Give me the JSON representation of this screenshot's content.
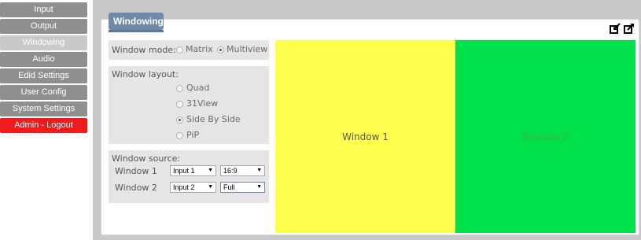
{
  "sidebar": {
    "items": [
      {
        "label": "Input"
      },
      {
        "label": "Output"
      },
      {
        "label": "Windowing"
      },
      {
        "label": "Audio"
      },
      {
        "label": "Edid Settings"
      },
      {
        "label": "User Config"
      },
      {
        "label": "System Settings"
      },
      {
        "label": "Admin - Logout"
      }
    ]
  },
  "page": {
    "title": "Windowing"
  },
  "window_mode": {
    "label": "Window mode:",
    "options": [
      "Matrix",
      "Multiview"
    ],
    "selected": "Multiview"
  },
  "window_layout": {
    "label": "Window layout:",
    "options": [
      "Quad",
      "31View",
      "Side By Side",
      "PiP"
    ],
    "selected": "Side By Side"
  },
  "window_source": {
    "label": "Window source:",
    "rows": [
      {
        "name": "Window 1",
        "input": "Input 1",
        "aspect": "16:9"
      },
      {
        "name": "Window 2",
        "input": "Input 2",
        "aspect": "Full"
      }
    ]
  },
  "preview": {
    "window1": {
      "label": "Window 1",
      "color": "#ffff4f"
    },
    "window2": {
      "label": "Window 2",
      "color": "#00e04a"
    }
  },
  "colors": {
    "accent": "#6e89a9",
    "logout": "#ee1c1c"
  },
  "icons": [
    "import-icon",
    "export-icon"
  ]
}
